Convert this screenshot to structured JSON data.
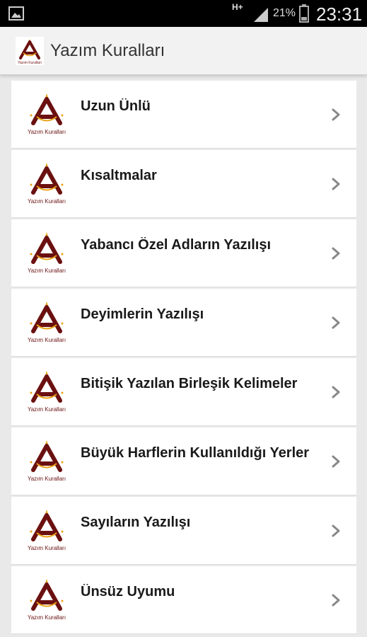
{
  "status_bar": {
    "network": "H+",
    "battery_percent": "21%",
    "time": "23:31"
  },
  "app_bar": {
    "title": "Yazım Kuralları",
    "logo_text": "Yazım Kuralları"
  },
  "colors": {
    "logo_a": "#6b1010",
    "logo_star": "#e8a317",
    "logo_text": "#6b1010"
  },
  "items": [
    {
      "label": "Uzun Ünlü",
      "logo_text": "Yazım Kuralları"
    },
    {
      "label": "Kısaltmalar",
      "logo_text": "Yazım Kuralları"
    },
    {
      "label": "Yabancı Özel Adların Yazılışı",
      "logo_text": "Yazım Kuralları"
    },
    {
      "label": "Deyimlerin Yazılışı",
      "logo_text": "Yazım Kuralları"
    },
    {
      "label": "Bitişik Yazılan Birleşik Kelimeler",
      "logo_text": "Yazım Kuralları"
    },
    {
      "label": "Büyük Harflerin Kullanıldığı Yerler",
      "logo_text": "Yazım Kuralları"
    },
    {
      "label": "Sayıların Yazılışı",
      "logo_text": "Yazım Kuralları"
    },
    {
      "label": "Ünsüz Uyumu",
      "logo_text": "Yazım Kuralları"
    }
  ]
}
